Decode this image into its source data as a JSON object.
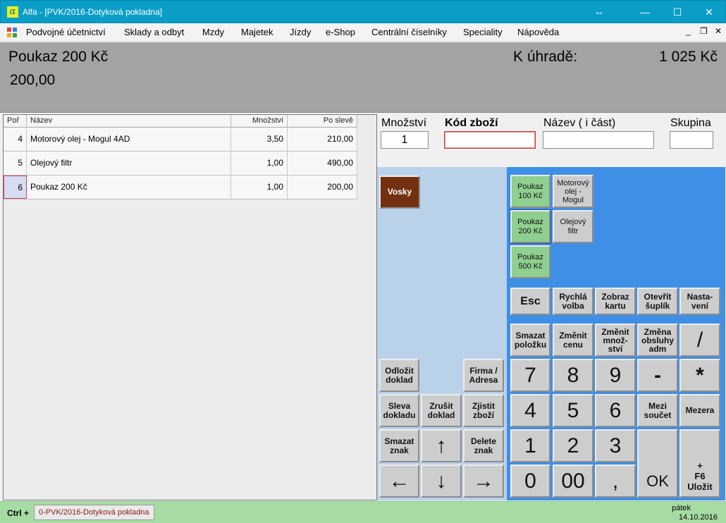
{
  "window": {
    "app_icon": "α",
    "title": "Alfa - [PVK/2016-Dotyková pokladna]",
    "resize_icon": "↔",
    "minimize": "—",
    "maximize": "☐",
    "close": "✕"
  },
  "menu": {
    "items": [
      "Podvojné účetnictví",
      "Sklady a odbyt",
      "Mzdy",
      "Majetek",
      "Jízdy",
      "e-Shop",
      "Centrální číselníky",
      "Speciality",
      "Nápověda"
    ],
    "mdi_minimize": "_",
    "mdi_restore": "❐",
    "mdi_close": "✕"
  },
  "header": {
    "item_name": "Poukaz 200 Kč",
    "item_price": "200,00",
    "due_label": "K úhradě:",
    "due_total": "1 025 Kč"
  },
  "table": {
    "columns": [
      "Poř",
      "Název",
      "Množství",
      "Po slevě"
    ],
    "rows": [
      {
        "no": "4",
        "name": "Motorový olej - Mogul 4AD",
        "qty": "3,50",
        "price": "210,00"
      },
      {
        "no": "5",
        "name": "Olejový filtr",
        "qty": "1,00",
        "price": "490,00"
      },
      {
        "no": "6",
        "name": "Poukaz 200 Kč",
        "qty": "1,00",
        "price": "200,00"
      }
    ]
  },
  "fields": {
    "qty_label": "Množství",
    "qty_value": "1",
    "code_label": "Kód zboží",
    "code_value": "",
    "name_label": "Název ( i část)",
    "name_value": "",
    "group_label": "Skupina",
    "group_value": ""
  },
  "groups": {
    "vosky": "Vosky"
  },
  "products": {
    "poukaz100": "Poukaz\n100 Kč",
    "motor_olej": "Motorový\nolej -\nMogul",
    "poukaz200": "Poukaz\n200 Kč",
    "olejovy_filtr": "Olejový\nfiltr",
    "poukaz500": "Poukaz\n500 Kč"
  },
  "nav": {
    "odlozit": "Odložit\ndoklad",
    "firma": "Firma /\nAdresa",
    "sleva": "Sleva\ndokladu",
    "zrusit": "Zrušit\ndoklad",
    "zjistit": "Zjistit\nzboží",
    "smazat_znak": "Smazat\nznak",
    "up": "↑",
    "delete_znak": "Delete\nznak",
    "left": "←",
    "down": "↓",
    "right": "→"
  },
  "keypad": {
    "esc": "Esc",
    "rychla": "Rychlá\nvolba",
    "zobraz": "Zobraz\nkartu",
    "otevrit": "Otevřít\nšuplík",
    "nastaveni": "Nasta-\nvení",
    "smazat_polozku": "Smazat\npoložku",
    "zmenit_cenu": "Změnit\ncenu",
    "zmenit_mnozstvi": "Změnit\nmnož-\nství",
    "zmena_obsluhy": "Změna\nobsluhy\nadm",
    "slash": "/",
    "k7": "7",
    "k8": "8",
    "k9": "9",
    "minus": "-",
    "star": "*",
    "k4": "4",
    "k5": "5",
    "k6": "6",
    "mezisoucet": "Mezi\nsoučet",
    "mezera": "Mezera",
    "k1": "1",
    "k2": "2",
    "k3": "3",
    "ok": "OK",
    "ulozit": "+\nF6\nUložit",
    "k0": "0",
    "k00": "00",
    "comma": ","
  },
  "status": {
    "ctrl": "Ctrl +",
    "doc_tab": "0-PVK/2016-Dotyková pokladna",
    "day": "pátek",
    "date": "14.10.2016"
  }
}
